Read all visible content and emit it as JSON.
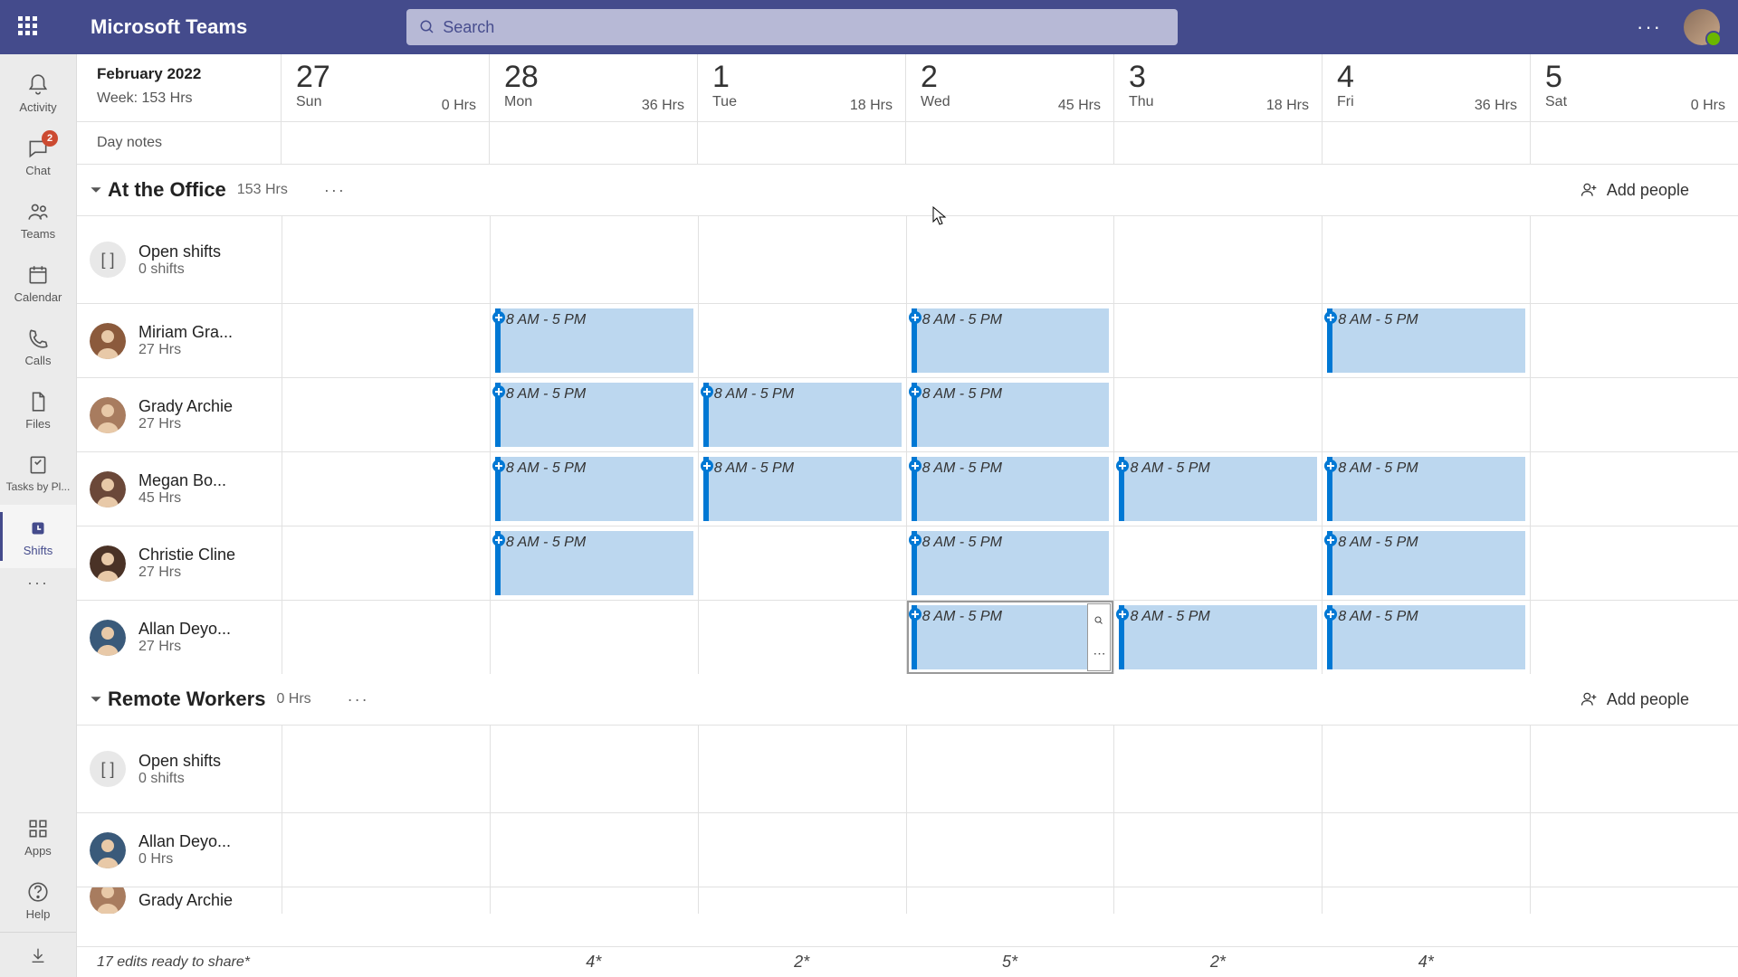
{
  "app": {
    "title": "Microsoft Teams"
  },
  "search": {
    "placeholder": "Search"
  },
  "rail": {
    "items": [
      {
        "id": "activity",
        "label": "Activity"
      },
      {
        "id": "chat",
        "label": "Chat",
        "badge": "2"
      },
      {
        "id": "teams",
        "label": "Teams"
      },
      {
        "id": "calendar",
        "label": "Calendar"
      },
      {
        "id": "calls",
        "label": "Calls"
      },
      {
        "id": "files",
        "label": "Files"
      },
      {
        "id": "tasks",
        "label": "Tasks by Pl..."
      },
      {
        "id": "shifts",
        "label": "Shifts"
      }
    ],
    "apps_label": "Apps",
    "help_label": "Help"
  },
  "header": {
    "month": "February 2022",
    "week_hrs": "Week: 153 Hrs",
    "days": [
      {
        "num": "27",
        "name": "Sun",
        "hrs": "0 Hrs"
      },
      {
        "num": "28",
        "name": "Mon",
        "hrs": "36 Hrs"
      },
      {
        "num": "1",
        "name": "Tue",
        "hrs": "18 Hrs"
      },
      {
        "num": "2",
        "name": "Wed",
        "hrs": "45 Hrs"
      },
      {
        "num": "3",
        "name": "Thu",
        "hrs": "18 Hrs"
      },
      {
        "num": "4",
        "name": "Fri",
        "hrs": "36 Hrs"
      },
      {
        "num": "5",
        "name": "Sat",
        "hrs": "0 Hrs"
      }
    ],
    "day_notes": "Day notes"
  },
  "groups": [
    {
      "name": "At the Office",
      "hrs": "153 Hrs",
      "add_label": "Add people",
      "rows": [
        {
          "type": "open",
          "name": "Open shifts",
          "sub": "0 shifts",
          "shifts": [
            null,
            null,
            null,
            null,
            null,
            null,
            null
          ]
        },
        {
          "type": "person",
          "name": "Miriam Gra...",
          "sub": "27 Hrs",
          "color": "#8b5a3c",
          "shifts": [
            null,
            "8 AM - 5 PM",
            null,
            "8 AM - 5 PM",
            null,
            "8 AM - 5 PM",
            null
          ]
        },
        {
          "type": "person",
          "name": "Grady Archie",
          "sub": "27 Hrs",
          "color": "#a87c5f",
          "shifts": [
            null,
            "8 AM - 5 PM",
            "8 AM - 5 PM",
            "8 AM - 5 PM",
            null,
            null,
            null
          ]
        },
        {
          "type": "person",
          "name": "Megan Bo...",
          "sub": "45 Hrs",
          "color": "#6b4839",
          "shifts": [
            null,
            "8 AM - 5 PM",
            "8 AM - 5 PM",
            "8 AM - 5 PM",
            "8 AM - 5 PM",
            "8 AM - 5 PM",
            null
          ]
        },
        {
          "type": "person",
          "name": "Christie Cline",
          "sub": "27 Hrs",
          "color": "#4a3226",
          "shifts": [
            null,
            "8 AM - 5 PM",
            null,
            "8 AM - 5 PM",
            null,
            "8 AM - 5 PM",
            null
          ]
        },
        {
          "type": "person",
          "name": "Allan Deyo...",
          "sub": "27 Hrs",
          "color": "#3a5a7a",
          "selected_day": 3,
          "shifts": [
            null,
            null,
            null,
            "8 AM - 5 PM",
            "8 AM - 5 PM",
            "8 AM - 5 PM",
            null
          ]
        }
      ]
    },
    {
      "name": "Remote Workers",
      "hrs": "0 Hrs",
      "add_label": "Add people",
      "rows": [
        {
          "type": "open",
          "name": "Open shifts",
          "sub": "0 shifts",
          "shifts": [
            null,
            null,
            null,
            null,
            null,
            null,
            null
          ]
        },
        {
          "type": "person",
          "name": "Allan Deyo...",
          "sub": "0 Hrs",
          "color": "#3a5a7a",
          "shifts": [
            null,
            null,
            null,
            null,
            null,
            null,
            null
          ]
        },
        {
          "type": "person",
          "name": "Grady Archie",
          "sub": "",
          "color": "#a87c5f",
          "cutoff": true,
          "shifts": [
            null,
            null,
            null,
            null,
            null,
            null,
            null
          ]
        }
      ]
    }
  ],
  "footer": {
    "status": "17 edits ready to share*",
    "counts": [
      "",
      "4*",
      "2*",
      "5*",
      "2*",
      "4*",
      ""
    ]
  }
}
